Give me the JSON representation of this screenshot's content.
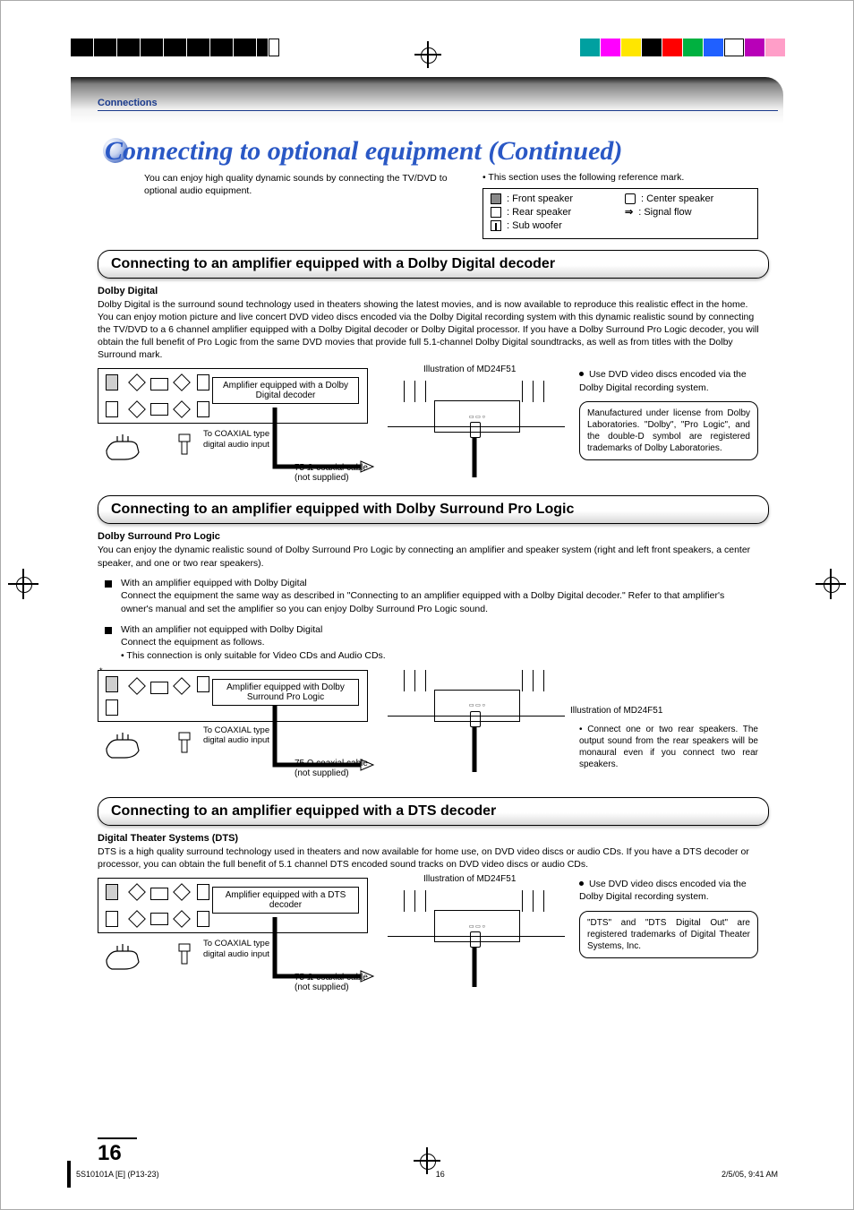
{
  "registration": {
    "swatch_colors": [
      "#00a0a0",
      "#ff00ff",
      "#ffe600",
      "#000000",
      "#ff0000",
      "#00b140",
      "#2060ff",
      "#ffffff",
      "#b800b8",
      "#ff9ec8"
    ]
  },
  "header": {
    "breadcrumb": "Connections",
    "title": "Connecting to optional equipment (Continued)"
  },
  "intro": {
    "left": "You can enjoy high quality dynamic sounds by connecting the TV/DVD to optional audio equipment.",
    "right_note": "• This section uses the following reference mark.",
    "legend": {
      "front": ": Front speaker",
      "rear": ": Rear speaker",
      "sub": ": Sub woofer",
      "center": ": Center speaker",
      "signal": ": Signal flow"
    }
  },
  "section1": {
    "heading": "Connecting to an amplifier equipped with a Dolby Digital decoder",
    "subhead": "Dolby Digital",
    "body": "Dolby Digital is the surround sound technology used in theaters showing the latest movies, and is now available to reproduce this realistic effect in the home. You can enjoy motion picture and live concert DVD video discs encoded via the Dolby Digital recording system with this dynamic realistic sound by connecting the TV/DVD to a 6 channel amplifier equipped with a Dolby Digital decoder or Dolby Digital processor. If you have a Dolby Surround Pro Logic decoder, you will obtain the full benefit of Pro Logic from the same DVD movies that provide full 5.1-channel Dolby Digital soundtracks, as well as from titles with the Dolby Surround mark.",
    "diagram": {
      "amp_label": "Amplifier equipped with a Dolby Digital decoder",
      "coax_label": "To COAXIAL type digital audio input",
      "cable_label": "75 Ω coaxial cable (not supplied)",
      "tv_caption": "Illustration of MD24F51"
    },
    "side": {
      "bullet": "Use DVD video discs encoded via the Dolby Digital recording system.",
      "box": "Manufactured under license from Dolby Laboratories. \"Dolby\", \"Pro Logic\", and the double-D symbol are registered trademarks of Dolby Laboratories."
    }
  },
  "section2": {
    "heading": "Connecting to an amplifier equipped with Dolby Surround Pro Logic",
    "subhead": "Dolby Surround Pro Logic",
    "body": "You can enjoy the dynamic realistic sound of Dolby Surround Pro Logic by connecting an amplifier and speaker system (right and left front speakers, a center speaker, and one or two rear speakers).",
    "bullet1_head": "With an amplifier equipped with Dolby Digital",
    "bullet1_body": "Connect the equipment the same way as described in \"Connecting to an amplifier equipped with a Dolby Digital decoder.\" Refer to that amplifier's owner's manual and set the amplifier so you can enjoy Dolby Surround Pro Logic sound.",
    "bullet2_head": "With an amplifier not equipped with Dolby Digital",
    "bullet2_body": "Connect the equipment as follows.",
    "bullet2_sub": "• This connection is only suitable for Video CDs and Audio CDs.",
    "diagram": {
      "amp_label": "Amplifier equipped with Dolby Surround Pro Logic",
      "coax_label": "To COAXIAL type digital audio input",
      "cable_label": "75 Ω coaxial cable (not supplied)",
      "tv_caption": "Illustration of MD24F51"
    },
    "side": {
      "box": "• Connect one or two rear speakers. The output sound from the rear speakers will be monaural even if you connect two rear speakers."
    }
  },
  "section3": {
    "heading": "Connecting to an amplifier equipped with a DTS decoder",
    "subhead": "Digital Theater Systems (DTS)",
    "body": "DTS is a high quality surround technology used in theaters and now available for home use, on DVD video discs or audio CDs. If you have a DTS decoder or processor, you can obtain the full benefit of 5.1 channel DTS encoded sound tracks on DVD video discs or audio CDs.",
    "diagram": {
      "amp_label": "Amplifier equipped with a DTS decoder",
      "coax_label": "To COAXIAL type digital audio input",
      "cable_label": "75 Ω coaxial cable (not supplied)",
      "tv_caption": "Illustration of MD24F51"
    },
    "side": {
      "bullet": "Use DVD video discs encoded via the Dolby Digital recording system.",
      "box": "\"DTS\" and \"DTS Digital Out\" are registered trademarks of Digital Theater Systems, Inc."
    }
  },
  "page_number": "16",
  "footer": {
    "left": "5S10101A [E] (P13-23)",
    "center": "16",
    "right": "2/5/05, 9:41 AM"
  }
}
